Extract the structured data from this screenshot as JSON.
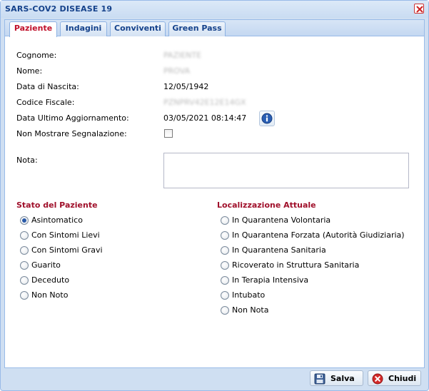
{
  "window": {
    "title": "SARS-COV2 DISEASE 19"
  },
  "tabs": [
    {
      "label": "Paziente",
      "active": true
    },
    {
      "label": "Indagini",
      "active": false
    },
    {
      "label": "Conviventi",
      "active": false
    },
    {
      "label": "Green Pass",
      "active": false
    }
  ],
  "patient": {
    "cognome_label": "Cognome:",
    "cognome_value": "PAZIENTE",
    "nome_label": "Nome:",
    "nome_value": "PROVA",
    "nascita_label": "Data di Nascita:",
    "nascita_value": "12/05/1942",
    "cf_label": "Codice Fiscale:",
    "cf_value": "PZNPRV42E12E14GX",
    "aggiornamento_label": "Data Ultimo Aggiornamento:",
    "aggiornamento_value": "03/05/2021 08:14:47",
    "segnalazione_label": "Non Mostrare Segnalazione:",
    "segnalazione_checked": false,
    "nota_label": "Nota:",
    "nota_value": ""
  },
  "stato": {
    "title": "Stato del Paziente",
    "options": [
      {
        "label": "Asintomatico",
        "checked": true
      },
      {
        "label": "Con Sintomi Lievi",
        "checked": false
      },
      {
        "label": "Con Sintomi Gravi",
        "checked": false
      },
      {
        "label": "Guarito",
        "checked": false
      },
      {
        "label": "Deceduto",
        "checked": false
      },
      {
        "label": "Non Noto",
        "checked": false
      }
    ]
  },
  "localizzazione": {
    "title": "Localizzazione Attuale",
    "options": [
      {
        "label": "In Quarantena Volontaria",
        "checked": false
      },
      {
        "label": "In Quarantena Forzata (Autorità Giudiziaria)",
        "checked": false
      },
      {
        "label": "In Quarantena Sanitaria",
        "checked": false
      },
      {
        "label": "Ricoverato in Struttura Sanitaria",
        "checked": false
      },
      {
        "label": "In Terapia Intensiva",
        "checked": false
      },
      {
        "label": "Intubato",
        "checked": false
      },
      {
        "label": "Non Nota",
        "checked": false
      }
    ]
  },
  "footer": {
    "salva_label": "Salva",
    "chiudi_label": "Chiudi"
  },
  "icons": {
    "close": "close-icon",
    "info": "info-icon",
    "save": "floppy-disk-icon",
    "cancel": "cancel-circle-icon"
  },
  "colors": {
    "accent_red": "#a0102b",
    "tab_active_text": "#c0112b",
    "tab_text": "#15428b",
    "frame": "#cfdff2"
  }
}
